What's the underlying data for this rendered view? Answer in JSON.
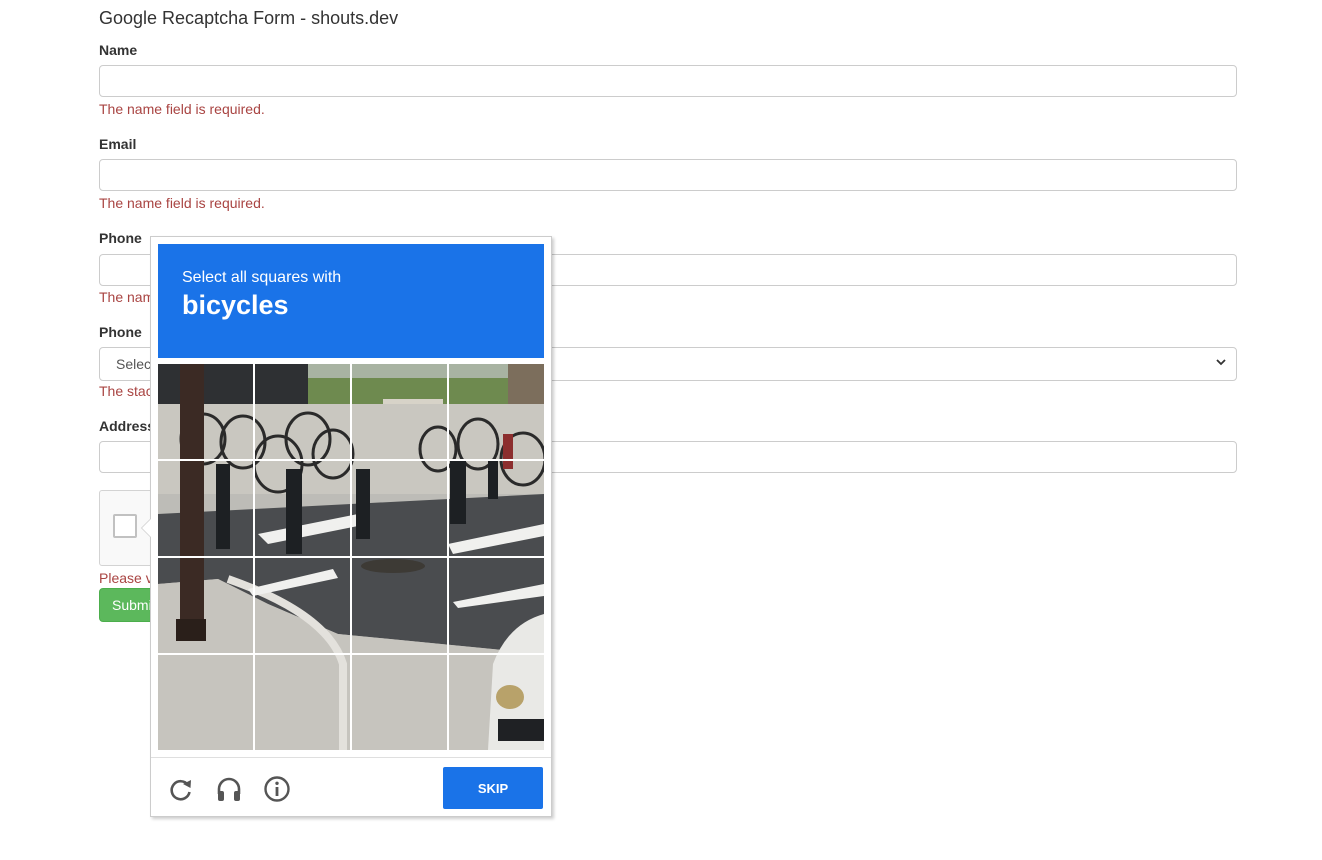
{
  "page": {
    "title": "Google Recaptcha Form - shouts.dev"
  },
  "form": {
    "name_label": "Name",
    "name_error": "The name field is required.",
    "email_label": "Email",
    "email_error": "The name field is required.",
    "phone_label": "Phone",
    "phone_error": "The nam",
    "state_label": "Phone",
    "state_select_value": "Selec",
    "state_error": "The stac",
    "address_label": "Address",
    "captcha_error": "Please v",
    "submit_label": "Submi"
  },
  "challenge": {
    "instruction": "Select all squares with",
    "target": "bicycles",
    "skip_label": "SKIP",
    "icons": [
      "reload-icon",
      "headphones-icon",
      "info-icon"
    ]
  },
  "colors": {
    "accent": "#1a73e8",
    "error": "#a94442",
    "success": "#5cb85c"
  }
}
